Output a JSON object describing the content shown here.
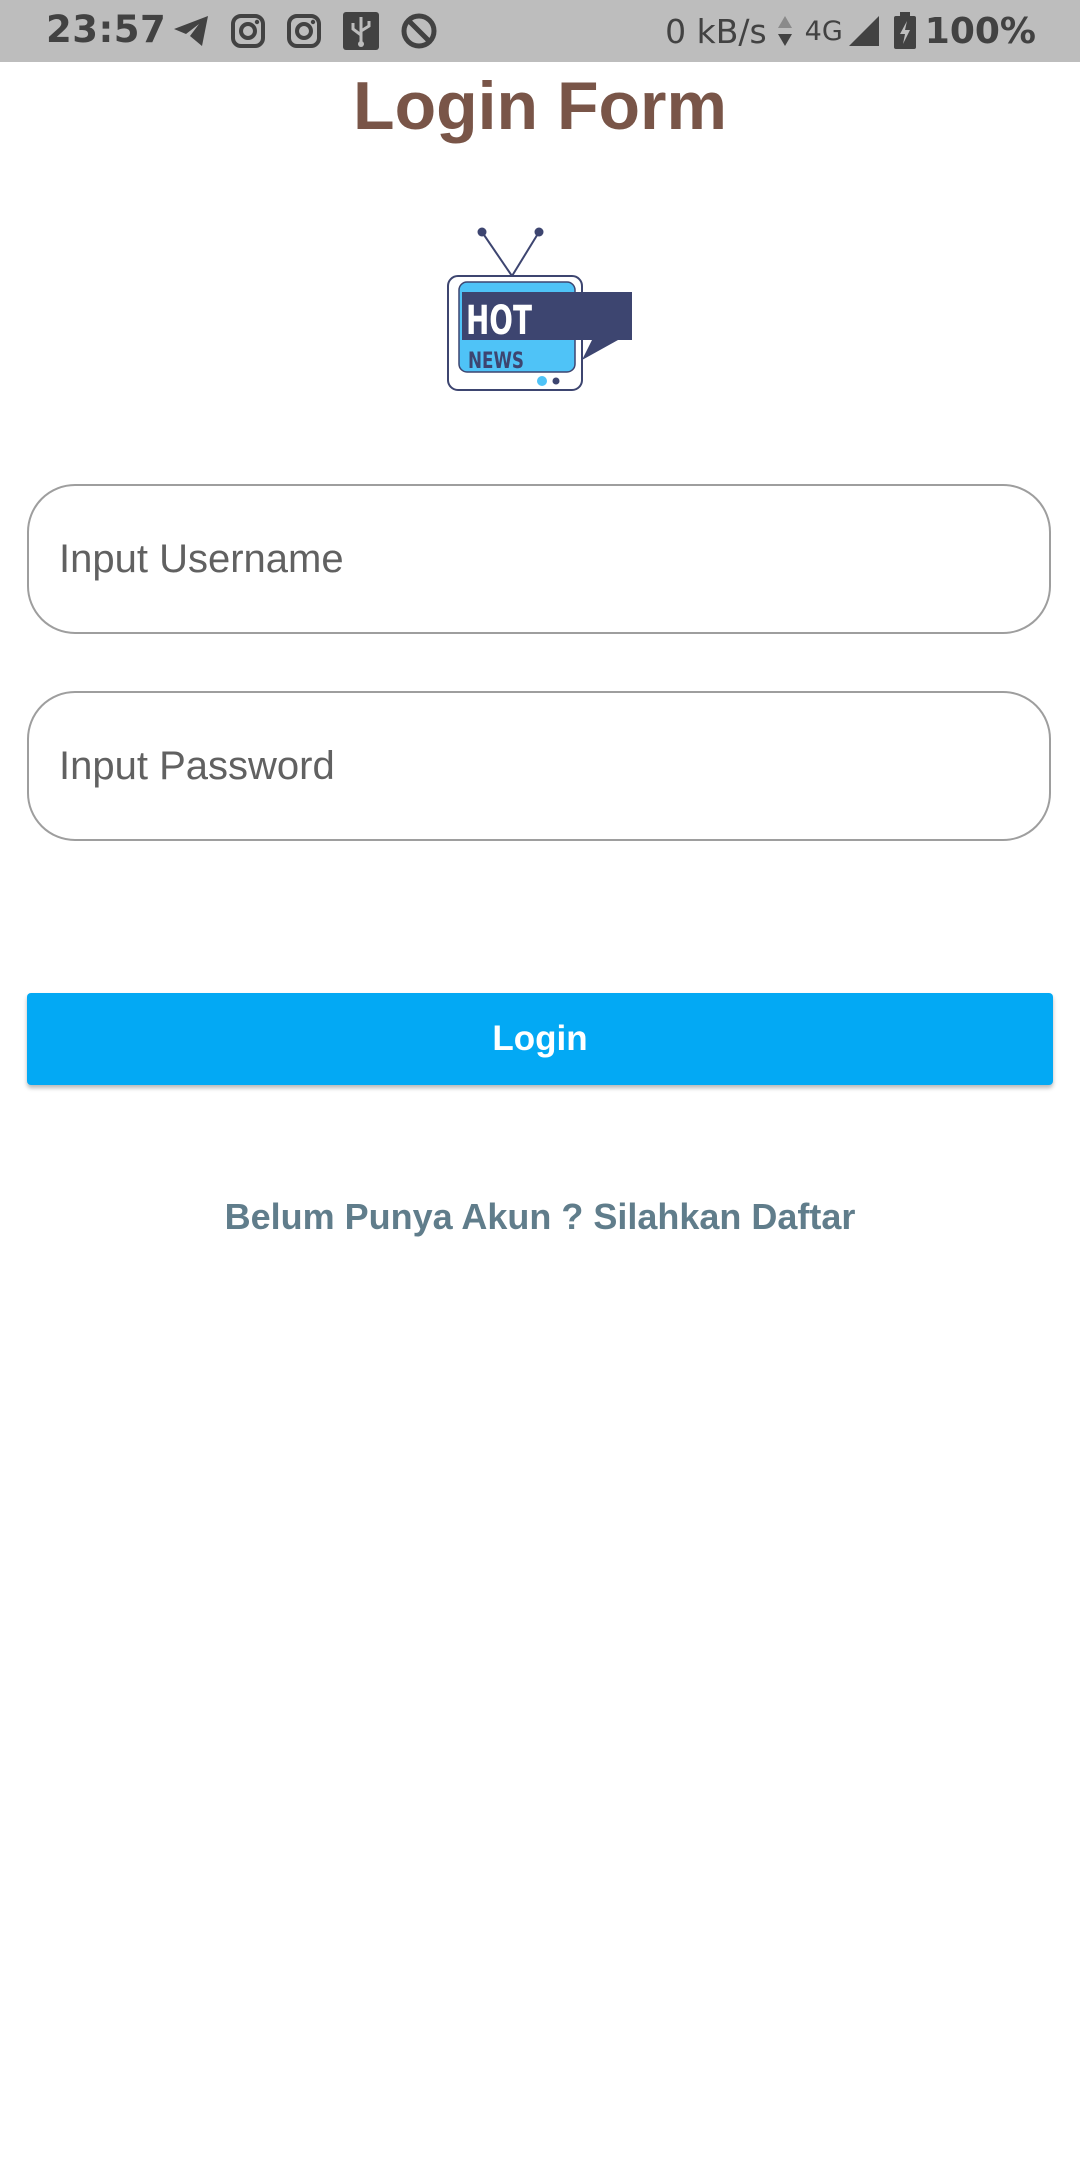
{
  "status_bar": {
    "time": "23:57",
    "net_speed": "0 kB/s",
    "network_type": "4G",
    "battery_percent": "100%",
    "icons": [
      "telegram-icon",
      "instagram-icon",
      "instagram-icon",
      "usb-icon",
      "data-saver-icon",
      "data-arrows-icon",
      "signal-icon",
      "battery-charging-icon"
    ]
  },
  "page": {
    "title": "Login Form"
  },
  "logo": {
    "line1": "HOT",
    "line2": "NEWS"
  },
  "form": {
    "username_placeholder": "Input Username",
    "username_value": "",
    "password_placeholder": "Input Password",
    "password_value": "",
    "login_label": "Login"
  },
  "register": {
    "link_text": "Belum Punya Akun ? Silahkan Daftar"
  },
  "colors": {
    "title": "#795548",
    "button": "#03a9f4",
    "link": "#607d8b",
    "status_bar": "#bdbdbd"
  }
}
